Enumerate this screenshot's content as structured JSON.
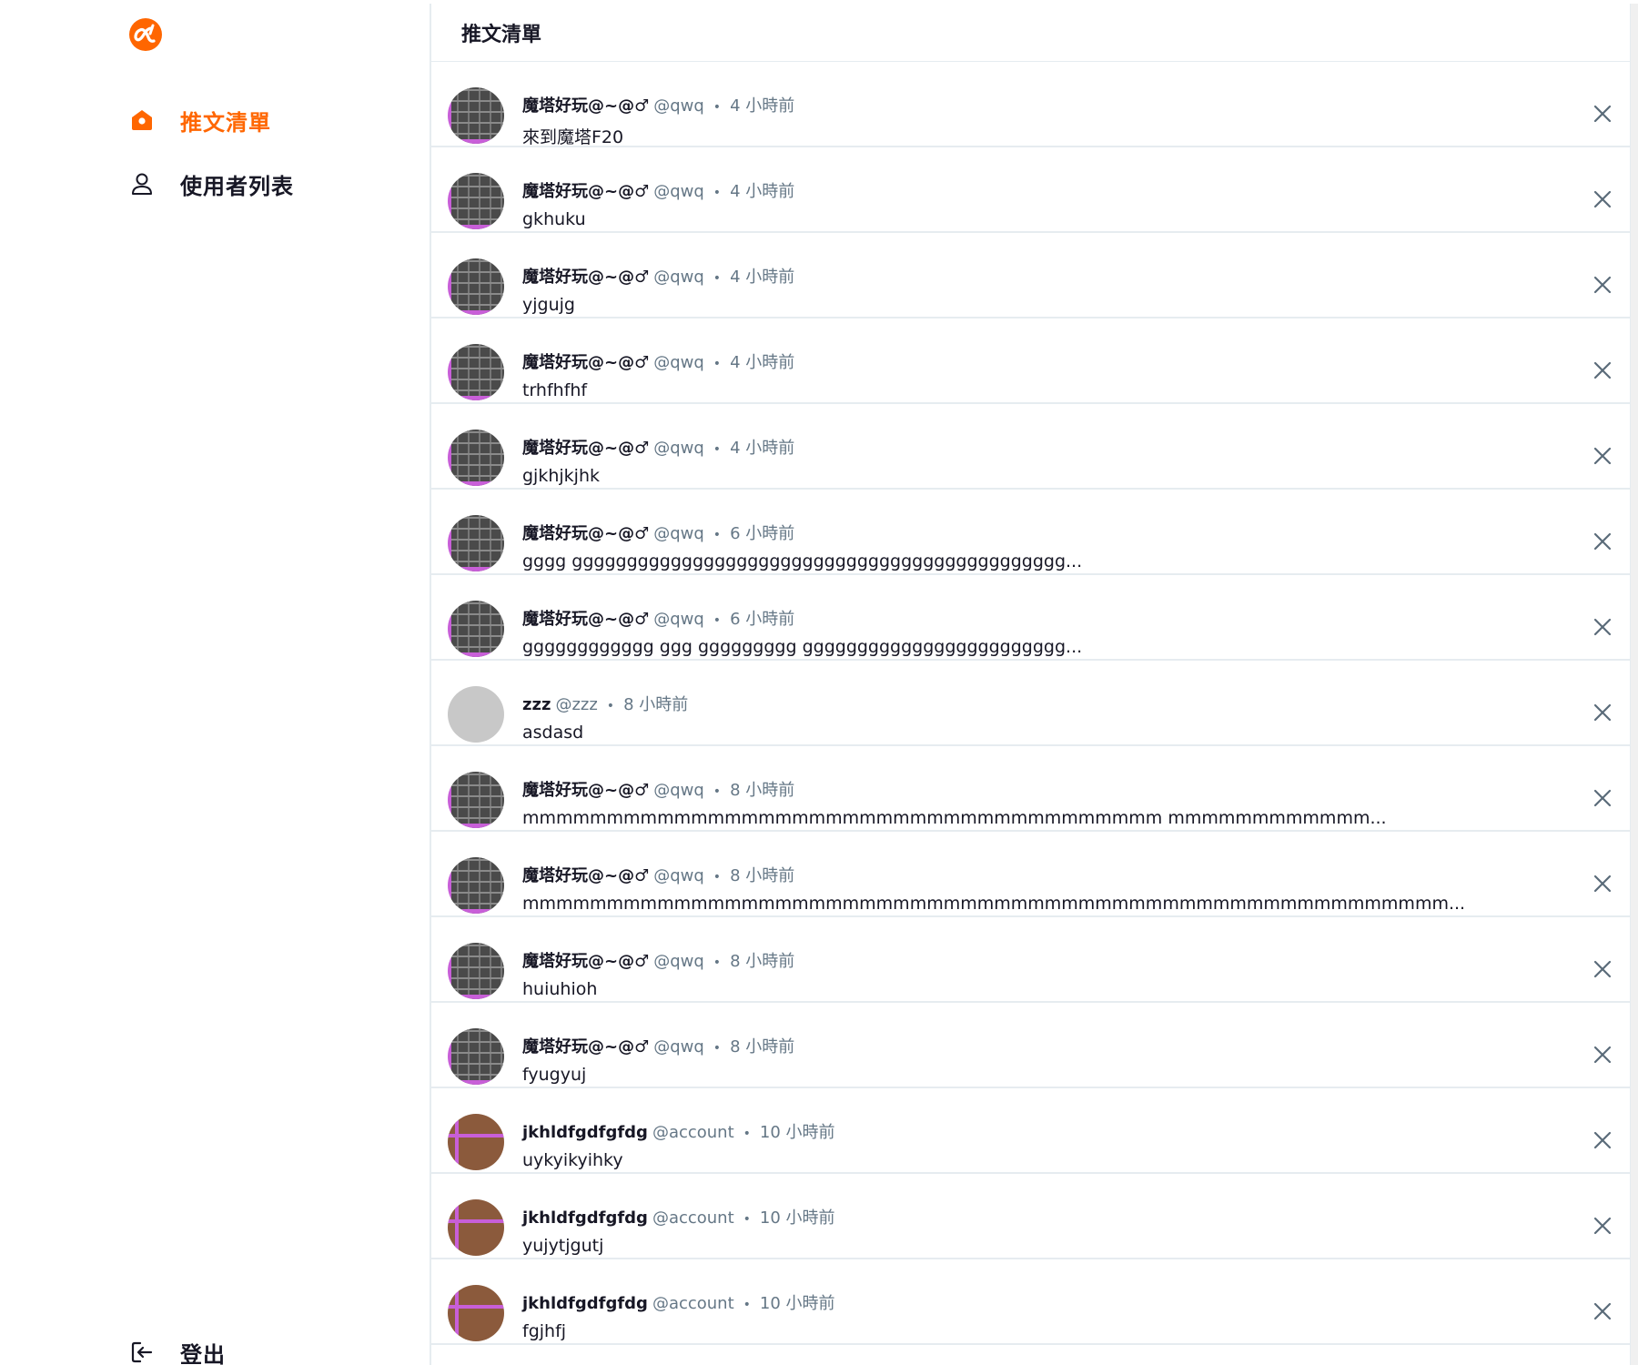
{
  "sidebar": {
    "logo_icon": "alpha-logo-icon",
    "accent_color": "#ff6600",
    "items": [
      {
        "label": "推文清單",
        "icon": "home-icon",
        "active": true
      },
      {
        "label": "使用者列表",
        "icon": "user-icon",
        "active": false
      }
    ],
    "logout_label": "登出"
  },
  "header": {
    "title": "推文清單"
  },
  "tweets": [
    {
      "name": "魔塔好玩@~@♂",
      "handle": "@qwq",
      "time": "4 小時前",
      "text": "來到魔塔F20",
      "avatar": "grid"
    },
    {
      "name": "魔塔好玩@~@♂",
      "handle": "@qwq",
      "time": "4 小時前",
      "text": "gkhuku",
      "avatar": "grid"
    },
    {
      "name": "魔塔好玩@~@♂",
      "handle": "@qwq",
      "time": "4 小時前",
      "text": "yjgujg",
      "avatar": "grid"
    },
    {
      "name": "魔塔好玩@~@♂",
      "handle": "@qwq",
      "time": "4 小時前",
      "text": "trhfhfhf",
      "avatar": "grid"
    },
    {
      "name": "魔塔好玩@~@♂",
      "handle": "@qwq",
      "time": "4 小時前",
      "text": "gjkhjkjhk",
      "avatar": "grid"
    },
    {
      "name": "魔塔好玩@~@♂",
      "handle": "@qwq",
      "time": "6 小時前",
      "text": "gggg ggggggggggggggggggggggggggggggggggggggggggggg...",
      "avatar": "grid"
    },
    {
      "name": "魔塔好玩@~@♂",
      "handle": "@qwq",
      "time": "6 小時前",
      "text": "gggggggggggg ggg ggggggggg gggggggggggggggggggggggg...",
      "avatar": "grid"
    },
    {
      "name": "zzz",
      "handle": "@zzz",
      "time": "8 小時前",
      "text": "asdasd",
      "avatar": "plain"
    },
    {
      "name": "魔塔好玩@~@♂",
      "handle": "@qwq",
      "time": "8 小時前",
      "text": "mmmmmmmmmmmmmmmmmmmmmmmmmmmmmmmmmmmmmm mmmmmmmmmmmm...",
      "avatar": "grid"
    },
    {
      "name": "魔塔好玩@~@♂",
      "handle": "@qwq",
      "time": "8 小時前",
      "text": "mmmmmmmmmmmmmmmmmmmmmmmmmmmmmmmmmmmmmmmmmmmmmmmmmmmmmmm...",
      "avatar": "grid"
    },
    {
      "name": "魔塔好玩@~@♂",
      "handle": "@qwq",
      "time": "8 小時前",
      "text": "huiuhioh",
      "avatar": "grid"
    },
    {
      "name": "魔塔好玩@~@♂",
      "handle": "@qwq",
      "time": "8 小時前",
      "text": "fyugyuj",
      "avatar": "grid"
    },
    {
      "name": "jkhldfgdfgfdg",
      "handle": "@account",
      "time": "10 小時前",
      "text": "uykyikyihky",
      "avatar": "brown"
    },
    {
      "name": "jkhldfgdfgfdg",
      "handle": "@account",
      "time": "10 小時前",
      "text": "yujytjgutj",
      "avatar": "brown"
    },
    {
      "name": "jkhldfgdfgfdg",
      "handle": "@account",
      "time": "10 小時前",
      "text": "fgjhfj",
      "avatar": "brown"
    }
  ]
}
